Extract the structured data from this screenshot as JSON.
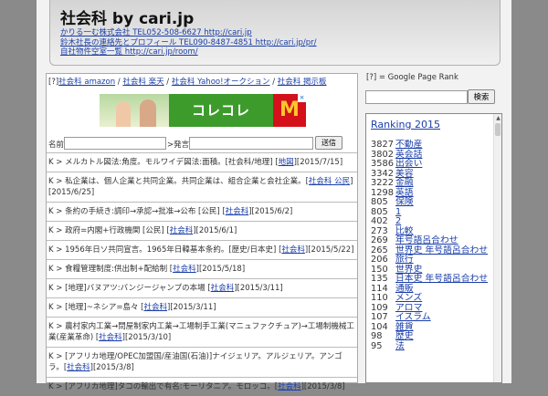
{
  "header": {
    "title": "社会科 by cari.jp",
    "links": [
      "かりる一む株式会社 TEL052-508-6627 http://cari.jp",
      "鈴木社長の連絡先とプロフィール TEL090-8487-4851 http://cari.jp/pr/",
      "自社物件空室一覧 http://cari.jp/room/"
    ]
  },
  "topnav": {
    "prefix": "[?]",
    "links": [
      "社会科 amazon",
      "社会科 楽天",
      "社会科 Yahoo!オークション",
      "社会科 掲示板"
    ],
    "separator": " / "
  },
  "ad": {
    "text": "コレコレ",
    "logo": "M",
    "close": "×"
  },
  "form": {
    "name_label": "名前",
    "message_label": ">発言",
    "submit_label": "送信"
  },
  "entries": [
    {
      "text": "K > メルカトル図法:角度。モルワイデ図法:面積。[社会科/地理] [",
      "link": "地図",
      "tail": "][2015/7/15]"
    },
    {
      "text": "K > 私企業は、個人企業と共同企業。共同企業は、組合企業と会社企業。[",
      "link": "社会科 公民",
      "tail": "][2015/6/25]"
    },
    {
      "text": "K > 条約の手続き:調印→承認→批准→公布 [公民] [",
      "link": "社会科",
      "tail": "][2015/6/2]"
    },
    {
      "text": "K > 政府=内閣+行政機関 [公民] [",
      "link": "社会科",
      "tail": "][2015/6/1]"
    },
    {
      "text": "K > 1956年日ソ共同宣言。1965年日韓基本条約。[歴史/日本史] [",
      "link": "社会科",
      "tail": "][2015/5/22]"
    },
    {
      "text": "K > 食糧管理制度:供出制+配給制 [",
      "link": "社会科",
      "tail": "][2015/5/18]"
    },
    {
      "text": "K > [地理]バヌアツ:バンジージャンプの本場 [",
      "link": "社会科",
      "tail": "][2015/3/11]"
    },
    {
      "text": "K > [地理]~ネシア=島々 [",
      "link": "社会科",
      "tail": "][2015/3/11]"
    },
    {
      "text": "K > 農村家内工業→問屋制家内工業→工場制手工業(マニュファクチュア)→工場制機械工業(産業革命) [",
      "link": "社会科",
      "tail": "][2015/3/10]"
    },
    {
      "text": "K > [アフリカ地理/OPEC加盟国/産油国(石油)]ナイジェリア。アルジェリア。アンゴラ。[",
      "link": "社会科",
      "tail": "][2015/3/8]"
    },
    {
      "text": "K > [アフリカ地理]タコの輸出で有名:モーリタニア。モロッコ。[",
      "link": "社会科",
      "tail": "][2015/3/8]"
    }
  ],
  "sidebar": {
    "note": "[?] = Google Page Rank",
    "search_button": "検索",
    "ranking_title": "Ranking 2015",
    "ranking": [
      {
        "count": "3827",
        "keyword": "不動産"
      },
      {
        "count": "3802",
        "keyword": "英会話"
      },
      {
        "count": "3586",
        "keyword": "出会い"
      },
      {
        "count": "3342",
        "keyword": "美容"
      },
      {
        "count": "3222",
        "keyword": "金融"
      },
      {
        "count": "1298",
        "keyword": "英語"
      },
      {
        "count": "805",
        "keyword": "保険"
      },
      {
        "count": "805",
        "keyword": "1"
      },
      {
        "count": "402",
        "keyword": "2"
      },
      {
        "count": "273",
        "keyword": "比較"
      },
      {
        "count": "269",
        "keyword": "年号語呂合わせ"
      },
      {
        "count": "265",
        "keyword": "世界史 年号語呂合わせ"
      },
      {
        "count": "206",
        "keyword": "旅行"
      },
      {
        "count": "150",
        "keyword": "世界史"
      },
      {
        "count": "135",
        "keyword": "日本史 年号語呂合わせ"
      },
      {
        "count": "114",
        "keyword": "通販"
      },
      {
        "count": "110",
        "keyword": "メンズ"
      },
      {
        "count": "109",
        "keyword": "アロマ"
      },
      {
        "count": "107",
        "keyword": "イスラム"
      },
      {
        "count": "104",
        "keyword": "雑貨"
      },
      {
        "count": "98",
        "keyword": "歴史"
      },
      {
        "count": "95",
        "keyword": "法"
      }
    ]
  }
}
